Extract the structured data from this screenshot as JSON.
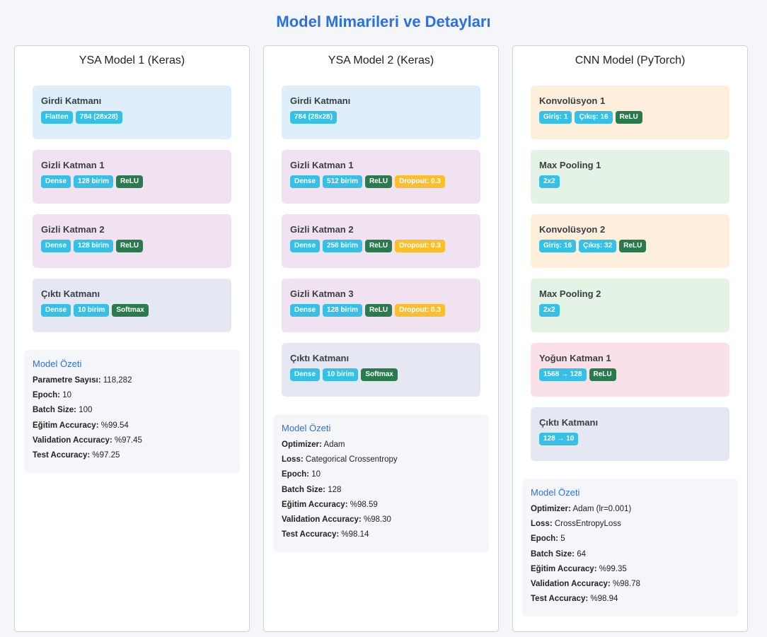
{
  "page_title": "Model Mimarileri ve Detayları",
  "colors": {
    "accent": "#2b6fe6",
    "info": "#36c0e6",
    "success": "#2b7a4d",
    "warning": "#fbbf2d"
  },
  "models": [
    {
      "title": "YSA Model 1 (Keras)",
      "layers": [
        {
          "name": "Girdi Katmanı",
          "kind": "input",
          "badges": [
            {
              "text": "Flatten",
              "style": "info"
            },
            {
              "text": "784 (28x28)",
              "style": "info"
            }
          ]
        },
        {
          "name": "Gizli Katman 1",
          "kind": "hidden",
          "badges": [
            {
              "text": "Dense",
              "style": "info"
            },
            {
              "text": "128 birim",
              "style": "info"
            },
            {
              "text": "ReLU",
              "style": "success"
            }
          ]
        },
        {
          "name": "Gizli Katman 2",
          "kind": "hidden",
          "badges": [
            {
              "text": "Dense",
              "style": "info"
            },
            {
              "text": "128 birim",
              "style": "info"
            },
            {
              "text": "ReLU",
              "style": "success"
            }
          ]
        },
        {
          "name": "Çıktı Katmanı",
          "kind": "output",
          "badges": [
            {
              "text": "Dense",
              "style": "info"
            },
            {
              "text": "10 birim",
              "style": "info"
            },
            {
              "text": "Softmax",
              "style": "success"
            }
          ]
        }
      ],
      "summary": {
        "title": "Model Özeti",
        "rows": [
          {
            "key": "Parametre Sayısı:",
            "value": "118,282"
          },
          {
            "key": "Epoch:",
            "value": "10"
          },
          {
            "key": "Batch Size:",
            "value": "100"
          },
          {
            "key": "Eğitim Accuracy:",
            "value": "%99.54"
          },
          {
            "key": "Validation Accuracy:",
            "value": "%97.45"
          },
          {
            "key": "Test Accuracy:",
            "value": "%97.25"
          }
        ]
      }
    },
    {
      "title": "YSA Model 2 (Keras)",
      "layers": [
        {
          "name": "Girdi Katmanı",
          "kind": "input",
          "badges": [
            {
              "text": "784 (28x28)",
              "style": "info"
            }
          ]
        },
        {
          "name": "Gizli Katman 1",
          "kind": "hidden",
          "badges": [
            {
              "text": "Dense",
              "style": "info"
            },
            {
              "text": "512 birim",
              "style": "info"
            },
            {
              "text": "ReLU",
              "style": "success"
            },
            {
              "text": "Dropout: 0.3",
              "style": "warning"
            }
          ]
        },
        {
          "name": "Gizli Katman 2",
          "kind": "hidden",
          "badges": [
            {
              "text": "Dense",
              "style": "info"
            },
            {
              "text": "256 birim",
              "style": "info"
            },
            {
              "text": "ReLU",
              "style": "success"
            },
            {
              "text": "Dropout: 0.3",
              "style": "warning"
            }
          ]
        },
        {
          "name": "Gizli Katman 3",
          "kind": "hidden",
          "badges": [
            {
              "text": "Dense",
              "style": "info"
            },
            {
              "text": "128 birim",
              "style": "info"
            },
            {
              "text": "ReLU",
              "style": "success"
            },
            {
              "text": "Dropout: 0.3",
              "style": "warning"
            }
          ]
        },
        {
          "name": "Çıktı Katmanı",
          "kind": "output",
          "badges": [
            {
              "text": "Dense",
              "style": "info"
            },
            {
              "text": "10 birim",
              "style": "info"
            },
            {
              "text": "Softmax",
              "style": "success"
            }
          ]
        }
      ],
      "summary": {
        "title": "Model Özeti",
        "rows": [
          {
            "key": "Optimizer:",
            "value": "Adam"
          },
          {
            "key": "Loss:",
            "value": "Categorical Crossentropy"
          },
          {
            "key": "Epoch:",
            "value": "10"
          },
          {
            "key": "Batch Size:",
            "value": "128"
          },
          {
            "key": "Eğitim Accuracy:",
            "value": "%98.59"
          },
          {
            "key": "Validation Accuracy:",
            "value": "%98.30"
          },
          {
            "key": "Test Accuracy:",
            "value": "%98.14"
          }
        ]
      }
    },
    {
      "title": "CNN Model (PyTorch)",
      "layers": [
        {
          "name": "Konvolüsyon 1",
          "kind": "conv",
          "badges": [
            {
              "text": "Giriş: 1",
              "style": "info"
            },
            {
              "text": "Çıkış: 16",
              "style": "info"
            },
            {
              "text": "ReLU",
              "style": "success"
            }
          ]
        },
        {
          "name": "Max Pooling 1",
          "kind": "pool",
          "badges": [
            {
              "text": "2x2",
              "style": "info"
            }
          ]
        },
        {
          "name": "Konvolüsyon 2",
          "kind": "conv",
          "badges": [
            {
              "text": "Giriş: 16",
              "style": "info"
            },
            {
              "text": "Çıkış: 32",
              "style": "info"
            },
            {
              "text": "ReLU",
              "style": "success"
            }
          ]
        },
        {
          "name": "Max Pooling 2",
          "kind": "pool",
          "badges": [
            {
              "text": "2x2",
              "style": "info"
            }
          ]
        },
        {
          "name": "Yoğun Katman 1",
          "kind": "dense",
          "badges": [
            {
              "text": "1568 → 128",
              "style": "info"
            },
            {
              "text": "ReLU",
              "style": "success"
            }
          ]
        },
        {
          "name": "Çıktı Katmanı",
          "kind": "output",
          "badges": [
            {
              "text": "128 → 10",
              "style": "info"
            }
          ]
        }
      ],
      "summary": {
        "title": "Model Özeti",
        "rows": [
          {
            "key": "Optimizer:",
            "value": "Adam (lr=0.001)"
          },
          {
            "key": "Loss:",
            "value": "CrossEntropyLoss"
          },
          {
            "key": "Epoch:",
            "value": "5"
          },
          {
            "key": "Batch Size:",
            "value": "64"
          },
          {
            "key": "Eğitim Accuracy:",
            "value": "%99.35"
          },
          {
            "key": "Validation Accuracy:",
            "value": "%98.78"
          },
          {
            "key": "Test Accuracy:",
            "value": "%98.94"
          }
        ]
      }
    }
  ]
}
